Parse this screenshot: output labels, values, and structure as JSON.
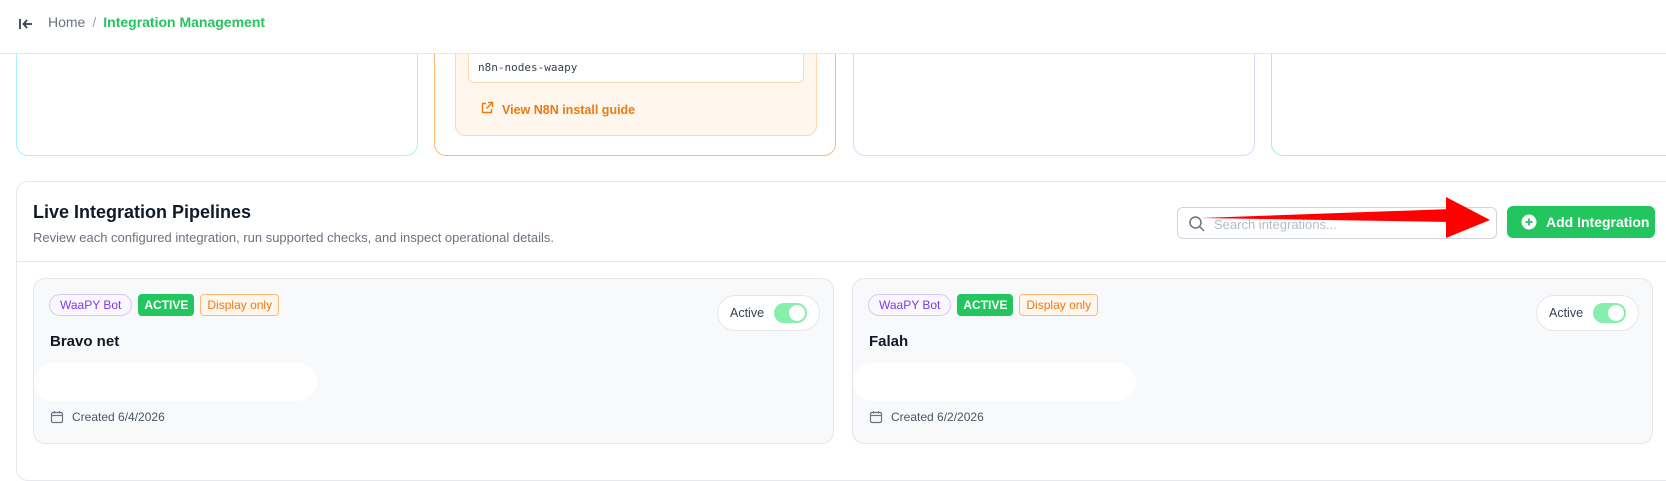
{
  "breadcrumb": {
    "home": "Home",
    "separator": "/",
    "current": "Integration Management"
  },
  "top_cards": {
    "package_code": "n8n-nodes-waapy",
    "guide_link": "View N8N install guide"
  },
  "pipelines": {
    "title": "Live Integration Pipelines",
    "subtitle": "Review each configured integration, run supported checks, and inspect operational details.",
    "search_placeholder": "Search integrations...",
    "add_button": "Add Integration"
  },
  "integrations": [
    {
      "type_badge": "WaaPY Bot",
      "status_badge": "ACTIVE",
      "mode_badge": "Display only",
      "name": "Bravo net",
      "toggle_label": "Active",
      "created": "Created 6/4/2026"
    },
    {
      "type_badge": "WaaPY Bot",
      "status_badge": "ACTIVE",
      "mode_badge": "Display only",
      "name": "Falah",
      "toggle_label": "Active",
      "created": "Created 6/2/2026"
    }
  ],
  "colors": {
    "accent": "#22c55e",
    "orange": "#ea7a12",
    "purple": "#7c3aed",
    "annotation_arrow": "#ff0000"
  }
}
